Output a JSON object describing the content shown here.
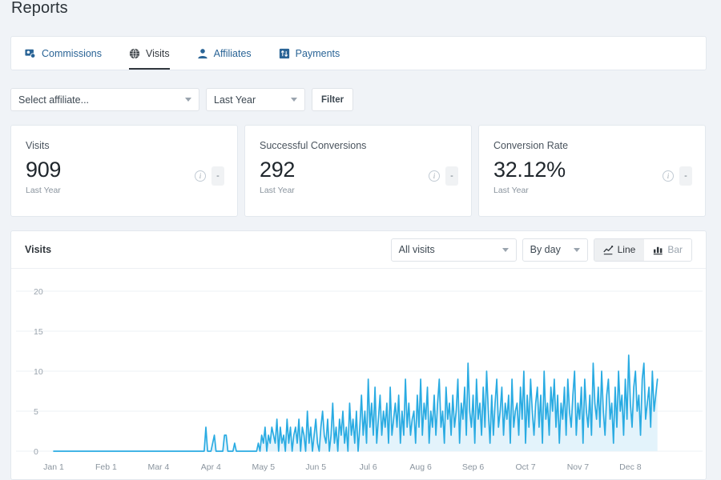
{
  "page": {
    "title": "Reports"
  },
  "tabs": [
    {
      "label": "Commissions",
      "icon": "commissions-icon",
      "active": false
    },
    {
      "label": "Visits",
      "icon": "globe-icon",
      "active": true
    },
    {
      "label": "Affiliates",
      "icon": "person-icon",
      "active": false
    },
    {
      "label": "Payments",
      "icon": "payments-icon",
      "active": false
    }
  ],
  "filters": {
    "affiliate": {
      "value": "Select affiliate...",
      "placeholder": "Select affiliate..."
    },
    "period": {
      "value": "Last Year"
    },
    "filter_button": "Filter"
  },
  "stats": [
    {
      "label": "Visits",
      "value": "909",
      "sub": "Last Year",
      "delta": "-"
    },
    {
      "label": "Successful Conversions",
      "value": "292",
      "sub": "Last Year",
      "delta": "-"
    },
    {
      "label": "Conversion Rate",
      "value": "32.12%",
      "sub": "Last Year",
      "delta": "-"
    }
  ],
  "chart_panel": {
    "title": "Visits",
    "visits_filter": "All visits",
    "interval": "By day",
    "line_label": "Line",
    "bar_label": "Bar",
    "active_view": "Line"
  },
  "colors": {
    "page_bg": "#f0f3f7",
    "card_bg": "#ffffff",
    "card_border": "#e3e8ee",
    "link_blue": "#2a6496",
    "text_dark": "#31373d",
    "line_stroke": "#29abe2",
    "area_fill": "#e3f3fb",
    "grid": "#eef1f4"
  },
  "chart_data": {
    "type": "line",
    "title": "Visits",
    "xlabel": "",
    "ylabel": "",
    "ylim": [
      0,
      22
    ],
    "yticks": [
      0,
      5,
      10,
      15,
      20
    ],
    "grid": true,
    "legend": "none",
    "xtick_labels": [
      "Jan 1",
      "Feb 1",
      "Mar 4",
      "Apr 4",
      "May 5",
      "Jun 5",
      "Jul 6",
      "Aug 6",
      "Sep 6",
      "Oct 7",
      "Nov 7",
      "Dec 8"
    ],
    "xtick_indices": [
      0,
      31,
      62,
      93,
      124,
      155,
      186,
      217,
      248,
      279,
      310,
      341
    ],
    "series": [
      {
        "name": "Visits",
        "values": [
          0,
          0,
          0,
          0,
          0,
          0,
          0,
          0,
          0,
          0,
          0,
          0,
          0,
          0,
          0,
          0,
          0,
          0,
          0,
          0,
          0,
          0,
          0,
          0,
          0,
          0,
          0,
          0,
          0,
          0,
          0,
          0,
          0,
          0,
          0,
          0,
          0,
          0,
          0,
          0,
          0,
          0,
          0,
          0,
          0,
          0,
          0,
          0,
          0,
          0,
          0,
          0,
          0,
          0,
          0,
          0,
          0,
          0,
          0,
          0,
          0,
          0,
          0,
          0,
          0,
          0,
          0,
          0,
          0,
          0,
          0,
          0,
          0,
          0,
          0,
          0,
          0,
          0,
          0,
          0,
          0,
          0,
          0,
          0,
          0,
          0,
          0,
          0,
          0,
          0,
          3,
          0,
          0,
          0,
          1,
          2,
          0,
          0,
          0,
          0,
          0,
          2,
          2,
          0,
          0,
          0,
          0,
          1,
          0,
          0,
          0,
          0,
          0,
          0,
          0,
          0,
          0,
          0,
          0,
          0,
          0,
          1,
          0,
          2,
          1,
          3,
          0,
          2,
          1,
          3,
          2,
          1,
          4,
          0,
          3,
          1,
          2,
          0,
          4,
          1,
          3,
          0,
          2,
          3,
          1,
          4,
          0,
          3,
          2,
          0,
          5,
          1,
          3,
          0,
          2,
          4,
          1,
          0,
          3,
          5,
          2,
          1,
          4,
          0,
          2,
          6,
          1,
          3,
          0,
          4,
          2,
          5,
          1,
          3,
          0,
          6,
          2,
          4,
          1,
          5,
          0,
          3,
          7,
          2,
          5,
          1,
          9,
          3,
          6,
          2,
          8,
          1,
          4,
          7,
          2,
          5,
          3,
          6,
          1,
          8,
          2,
          4,
          6,
          3,
          7,
          1,
          5,
          2,
          9,
          3,
          6,
          2,
          4,
          5,
          1,
          7,
          3,
          9,
          2,
          6,
          4,
          8,
          1,
          5,
          3,
          7,
          2,
          6,
          9,
          3,
          5,
          1,
          8,
          4,
          6,
          2,
          7,
          3,
          5,
          9,
          1,
          6,
          4,
          8,
          2,
          11,
          5,
          3,
          7,
          1,
          9,
          4,
          6,
          2,
          8,
          3,
          10,
          5,
          1,
          7,
          2,
          6,
          9,
          3,
          5,
          8,
          2,
          6,
          4,
          7,
          1,
          9,
          3,
          5,
          6,
          2,
          8,
          4,
          10,
          1,
          7,
          3,
          9,
          5,
          2,
          6,
          8,
          3,
          7,
          1,
          10,
          4,
          6,
          2,
          8,
          5,
          9,
          3,
          7,
          1,
          6,
          4,
          8,
          2,
          9,
          5,
          3,
          7,
          10,
          2,
          6,
          4,
          8,
          1,
          9,
          5,
          3,
          7,
          2,
          11,
          6,
          4,
          8,
          3,
          10,
          5,
          2,
          7,
          9,
          4,
          6,
          1,
          8,
          3,
          10,
          5,
          7,
          2,
          9,
          4,
          12,
          6,
          3,
          8,
          10,
          5,
          7,
          2,
          9,
          11,
          4,
          6,
          8,
          3,
          10,
          5,
          7,
          9
        ]
      }
    ]
  }
}
